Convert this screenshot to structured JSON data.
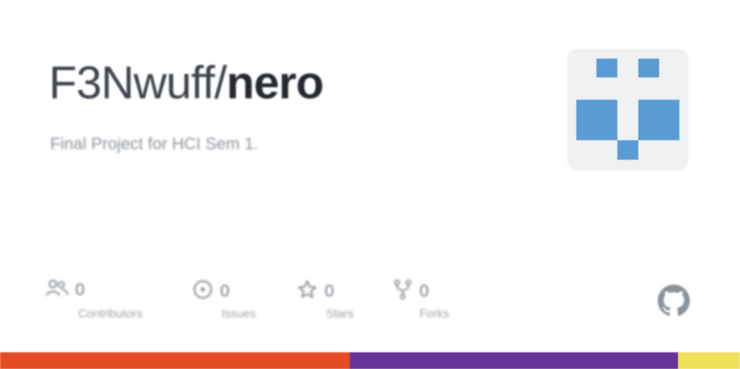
{
  "repo": {
    "owner": "F3Nwuff/",
    "name": "nero",
    "description": "Final Project for HCI Sem 1."
  },
  "stats": [
    {
      "value": "0",
      "label": "Contributors",
      "icon": "people-icon"
    },
    {
      "value": "0",
      "label": "Issues",
      "icon": "issue-icon"
    },
    {
      "value": "0",
      "label": "Stars",
      "icon": "star-icon"
    },
    {
      "value": "0",
      "label": "Forks",
      "icon": "fork-icon"
    }
  ],
  "brand_icon": "github-logo-icon",
  "colors": {
    "avatar_block": "#5b9bd5",
    "avatar_bg": "#f0f1f3",
    "lang_1": "#e34c26",
    "lang_2": "#663399",
    "lang_3": "#f1e05a"
  },
  "language_bar": [
    {
      "color": "#e34c26",
      "fraction": 0.473
    },
    {
      "color": "#663399",
      "fraction": 0.443
    },
    {
      "color": "#f1e05a",
      "fraction": 0.084
    }
  ]
}
